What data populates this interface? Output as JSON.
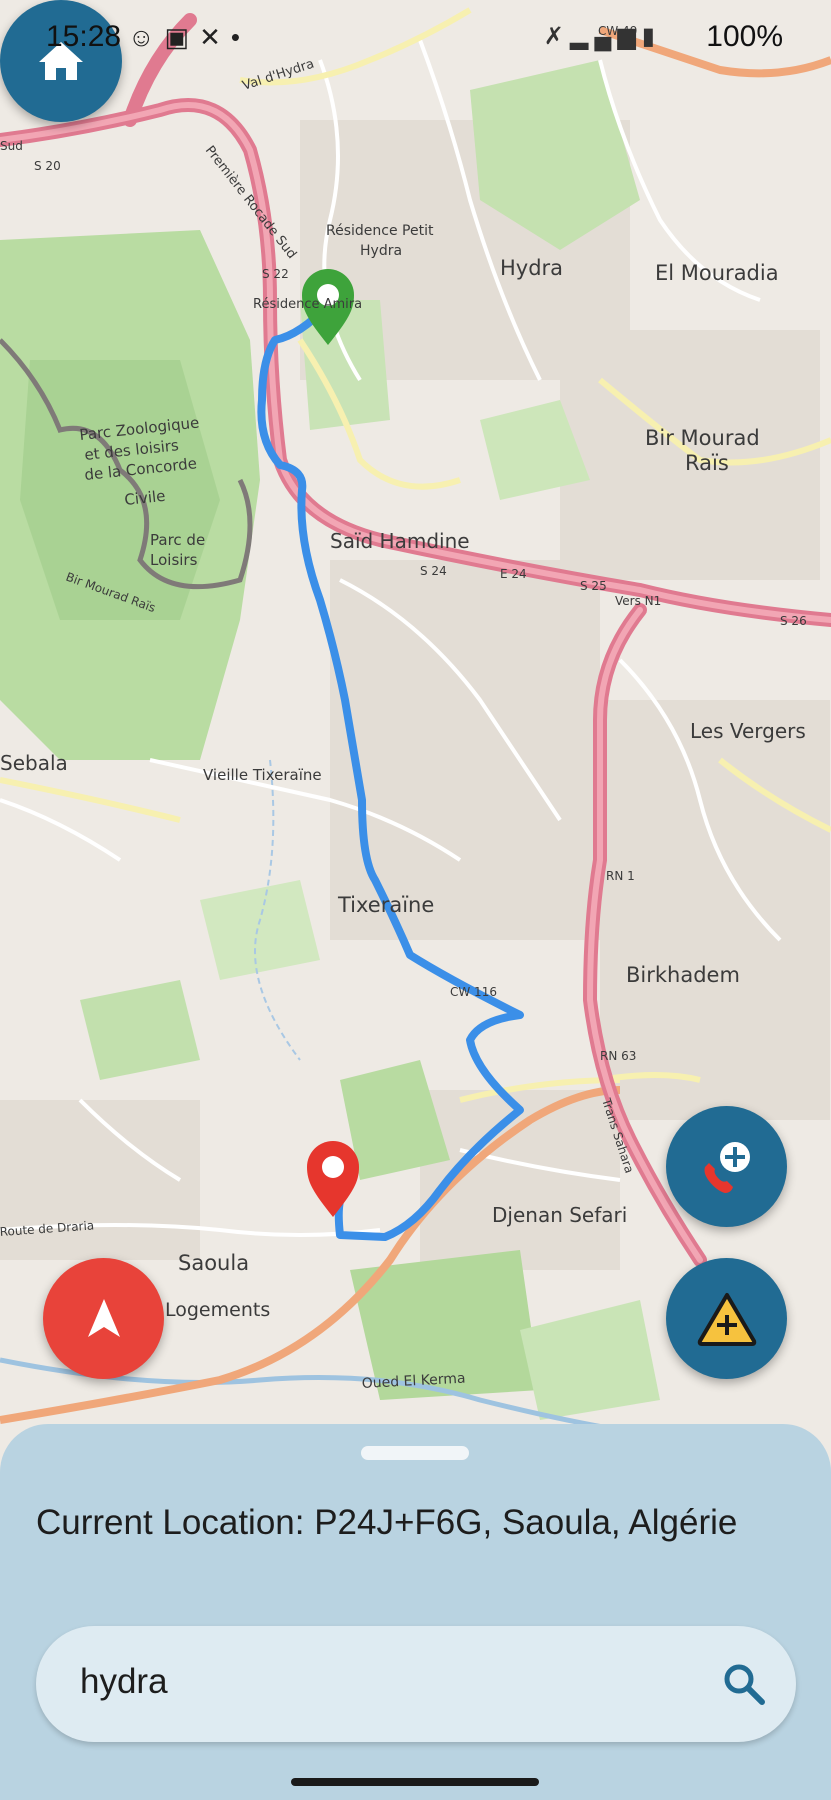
{
  "status_bar": {
    "time": "15:28",
    "battery": "100%",
    "left_icons": [
      "snapchat-icon",
      "gallery-icon",
      "missed-call-icon",
      "dot-icon"
    ],
    "right_icons": [
      "mute-icon",
      "4g-icon",
      "signal-icon",
      "signal-icon",
      "battery-icon"
    ]
  },
  "map": {
    "labels": {
      "hydra": "Hydra",
      "el_mouradia": "El Mouradia",
      "residence_petit": "Résidence Petit",
      "hydra_small": "Hydra",
      "residence_amira": "Résidence Amira",
      "premiere_rocade": "Première Rocade Sud",
      "val_hydra": "Val d'Hydra",
      "parc_zoo_1": "Parc Zoologique",
      "parc_zoo_2": "et des loisirs",
      "parc_zoo_3": "de la Concorde",
      "parc_zoo_4": "Civile",
      "parc_loisirs_1": "Parc de",
      "parc_loisirs_2": "Loisirs",
      "bir_mourad_rais_1": "Bir Mourad",
      "bir_mourad_rais_2": "Raïs",
      "said_hamdine": "Saïd Hamdine",
      "s24": "S 24",
      "e24": "E 24",
      "s25": "S 25",
      "vers_n1": "Vers N1",
      "s26": "S 26",
      "s22": "S 22",
      "s20": "S 20",
      "les_vergers": "Les Vergers",
      "vieille_tixeraine": "Vieille Tixeraïne",
      "sebala": "Sebala",
      "tixeraine": "Tixeraïne",
      "rn1": "RN 1",
      "birkhadem": "Birkhadem",
      "cw116": "CW 116",
      "rn63": "RN 63",
      "djenan_sefari": "Djenan Sefari",
      "saoula": "Saoula",
      "logements": "Logements",
      "route_draria": "Route de Draria",
      "oued_el_kerma": "Oued El Kerma",
      "trans_sahara": "Trans Sahara",
      "bir_mourad_road": "Bir Mourad Raïs",
      "sud": "Sud",
      "cw49": "CW 49"
    },
    "route_color": "#3b8fe8",
    "start_marker_color": "#3ea33b",
    "end_marker_color": "#e6362d"
  },
  "buttons": {
    "home": "home-icon",
    "navigate": "navigation-arrow-icon",
    "add_call": "add-call-icon",
    "add_alert": "add-alert-icon"
  },
  "bottom_sheet": {
    "current_location": "Current Location: P24J+F6G, Saoula, Algérie",
    "search_value": "hydra"
  },
  "colors": {
    "primary": "#216b93",
    "danger": "#e8433a",
    "sheet": "#b9d3e1",
    "search_bg": "#deebf2",
    "warning": "#f6c23e"
  }
}
